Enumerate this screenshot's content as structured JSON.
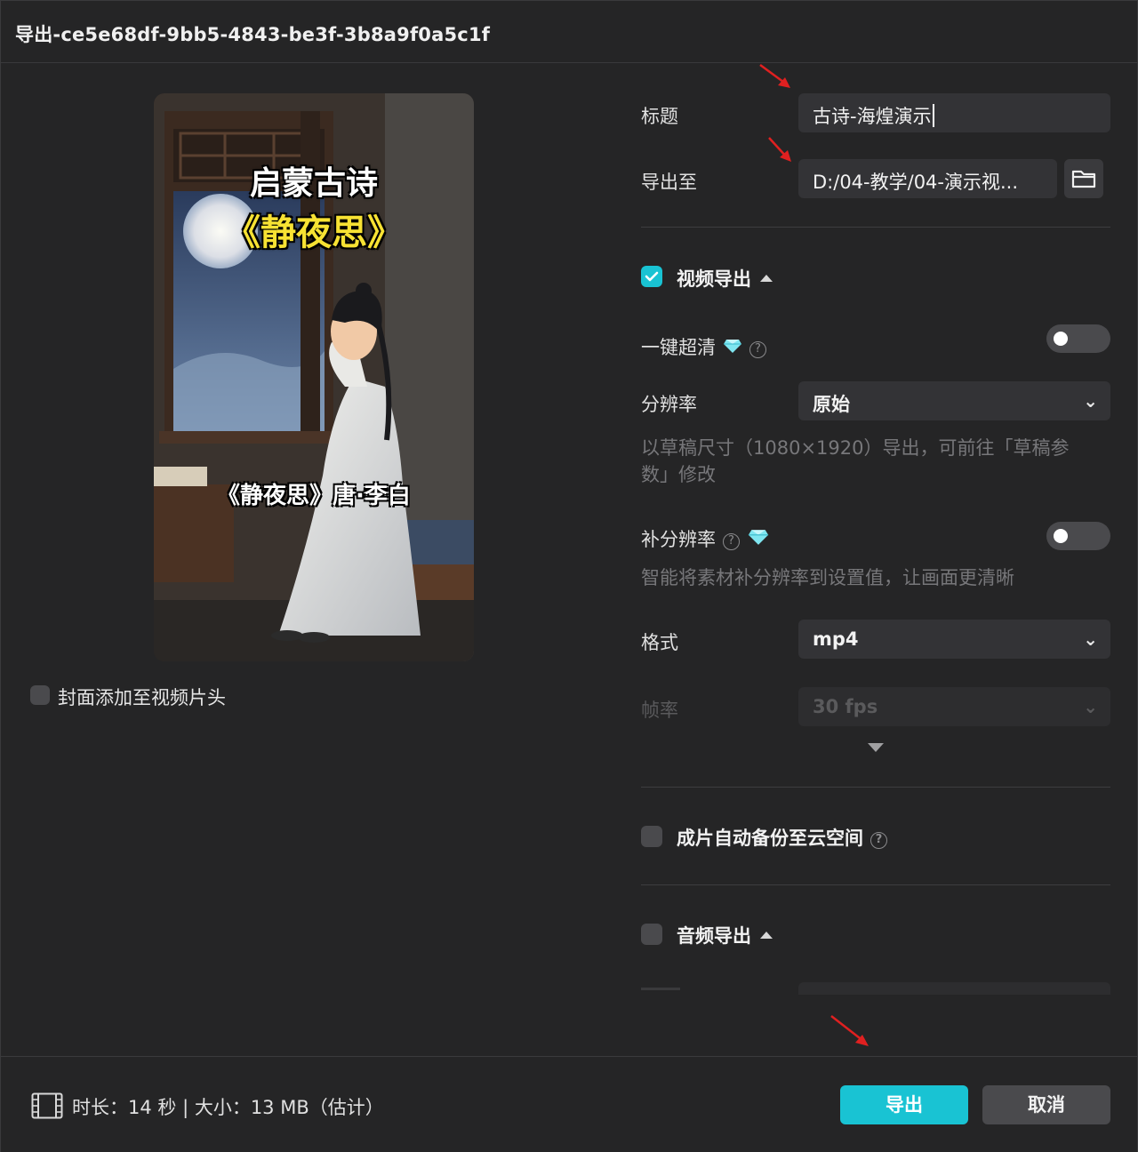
{
  "window": {
    "title": "导出-ce5e68df-9bb5-4843-be3f-3b8a9f0a5c1f"
  },
  "preview": {
    "poster_title_line1": "启蒙古诗",
    "poster_title_line2": "《静夜思》",
    "poster_subtitle": "《静夜思》唐·李白"
  },
  "cover": {
    "label": "封面添加至视频片头",
    "checked": false
  },
  "form": {
    "title_label": "标题",
    "title_value": "古诗-海煌演示",
    "export_to_label": "导出至",
    "export_to_value": "D:/04-教学/04-演示视..."
  },
  "video_export": {
    "label": "视频导出",
    "checked": true,
    "one_click_hd_label": "一键超清",
    "one_click_hd_on": false,
    "resolution_label": "分辨率",
    "resolution_value": "原始",
    "resolution_desc": "以草稿尺寸（1080×1920）导出，可前往「草稿参数」修改",
    "supplement_res_label": "补分辨率",
    "supplement_res_on": false,
    "supplement_res_desc": "智能将素材补分辨率到设置值，让画面更清晰",
    "format_label": "格式",
    "format_value": "mp4",
    "framerate_label": "帧率",
    "framerate_value": "30 fps"
  },
  "cloud_backup": {
    "label": "成片自动备份至云空间",
    "checked": false
  },
  "audio_export": {
    "label": "音频导出",
    "checked": false
  },
  "footer": {
    "info": "时长：14 秒 | 大小：13 MB（估计）",
    "export_button": "导出",
    "cancel_button": "取消"
  },
  "colors": {
    "accent": "#19c3d3",
    "annotation_arrow": "#e02020"
  }
}
